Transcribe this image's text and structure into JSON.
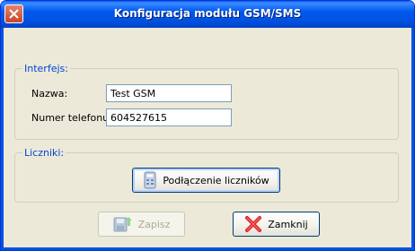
{
  "window": {
    "title": "Konfiguracja modułu GSM/SMS"
  },
  "interfejs_group": {
    "legend": "Interfejs:",
    "name_label": "Nazwa:",
    "name_value": "Test GSM",
    "phone_label": "Numer telefonu:",
    "phone_value": "604527615"
  },
  "liczniki_group": {
    "legend": "Liczniki:",
    "connect_button_label": "Podłączenie liczników"
  },
  "footer": {
    "save_label": "Zapisz",
    "close_label": "Zamknij"
  },
  "colors": {
    "titlebar": "#0054e3",
    "legend_text": "#0046d5",
    "close_icon": "#e02020",
    "save_icon_arrow": "#3cb043"
  },
  "icons": [
    "close-icon",
    "counter-device-icon",
    "save-icon",
    "red-x-icon"
  ]
}
